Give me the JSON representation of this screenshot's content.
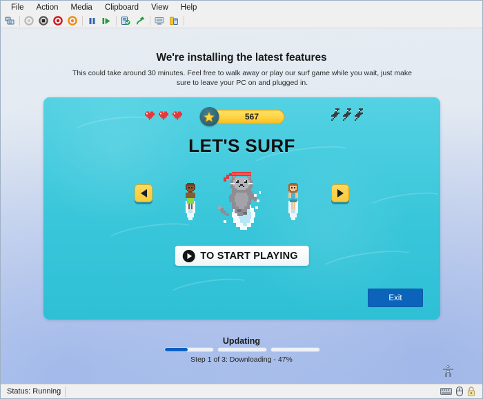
{
  "window": {
    "menu": [
      {
        "label": "File"
      },
      {
        "label": "Action"
      },
      {
        "label": "Media"
      },
      {
        "label": "Clipboard"
      },
      {
        "label": "View"
      },
      {
        "label": "Help"
      }
    ],
    "toolbar": [
      {
        "name": "ctrl-alt-del-icon",
        "title": "Ctrl+Alt+Delete"
      },
      {
        "name": "start-icon",
        "title": "Start"
      },
      {
        "name": "shutdown-icon",
        "title": "Shut Down"
      },
      {
        "name": "turn-off-icon",
        "title": "Turn Off"
      },
      {
        "name": "reset-icon",
        "title": "Reset"
      },
      {
        "name": "pause-icon",
        "title": "Pause"
      },
      {
        "name": "resume-icon",
        "title": "Resume"
      },
      {
        "name": "checkpoint-icon",
        "title": "Checkpoint"
      },
      {
        "name": "revert-icon",
        "title": "Revert"
      },
      {
        "name": "enhanced-session-icon",
        "title": "Enhanced Session"
      },
      {
        "name": "settings-icon",
        "title": "Settings"
      }
    ]
  },
  "oobe": {
    "heading": "We're installing the latest features",
    "subtext": "This could take around 30 minutes. Feel free to walk away or play our surf game while you wait, just make sure to leave your PC on and plugged in."
  },
  "game": {
    "title": "LET'S SURF",
    "hud": {
      "lives": 3,
      "lives_icon": "heart-icon",
      "boosts": 3,
      "boost_icon": "lightning-bolt-icon",
      "score": "567",
      "score_icon": "star-icon"
    },
    "prev_label": "◀",
    "next_label": "▶",
    "characters": [
      {
        "name": "surfer-boy",
        "selected": false
      },
      {
        "name": "surfer-cat",
        "selected": true
      },
      {
        "name": "surfer-girl",
        "selected": false
      }
    ],
    "start_button": {
      "icon": "play-circle-icon",
      "label": "TO START PLAYING"
    },
    "exit_button": "Exit",
    "colors": {
      "water": "#39c6da",
      "accent_yellow": "#ffd23f",
      "exit_blue": "#0b64ba"
    }
  },
  "update": {
    "title": "Updating",
    "status": "Step 1 of 3: Downloading - 47%",
    "percent": 47,
    "current_step": 1,
    "total_steps": 3,
    "bar_color": "#0b5fc4"
  },
  "statusbar": {
    "status": "Status: Running",
    "icons": [
      {
        "name": "keyboard-icon"
      },
      {
        "name": "mouse-icon"
      },
      {
        "name": "lock-icon"
      }
    ],
    "accessibility_icon": "accessibility-icon"
  }
}
